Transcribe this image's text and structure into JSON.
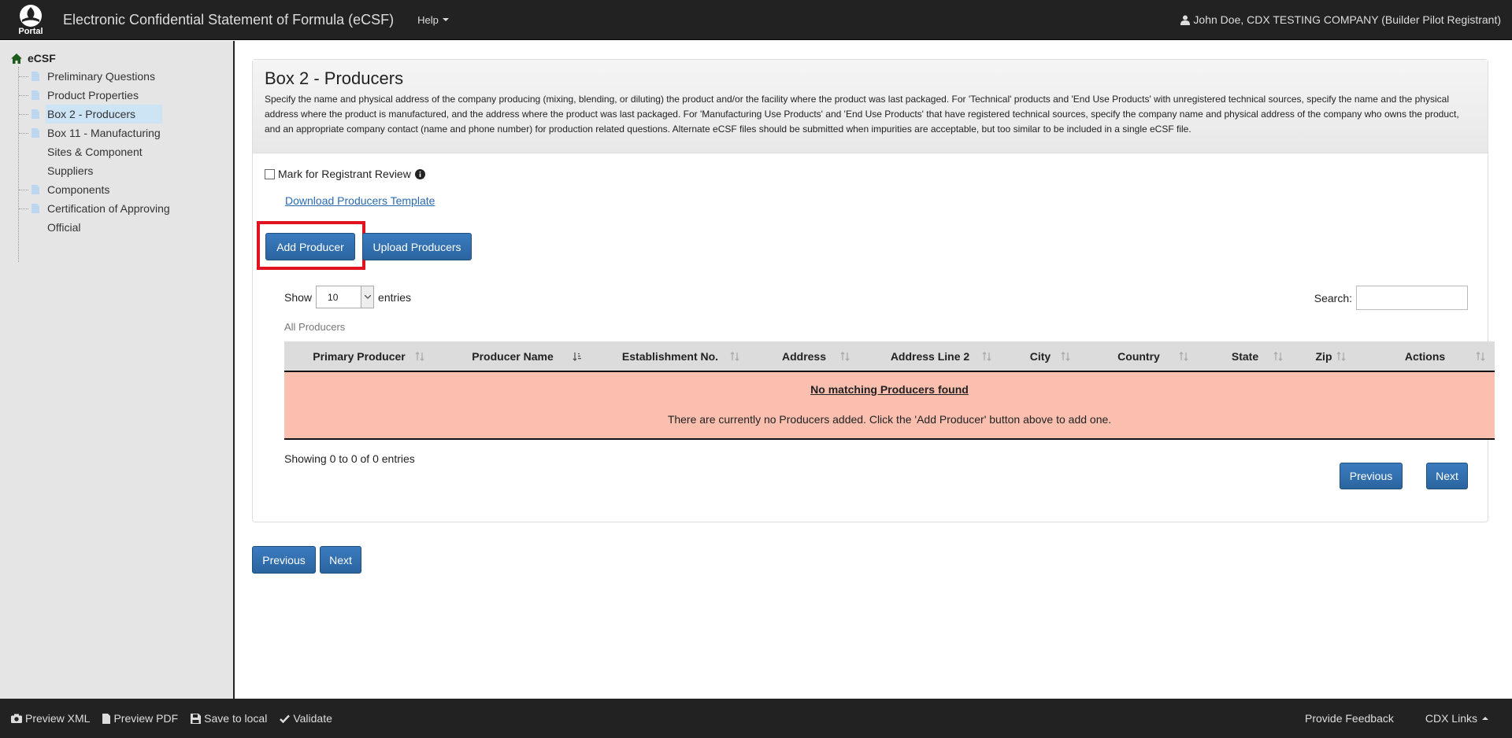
{
  "header": {
    "logo_text": "Portal",
    "app_title": "Electronic Confidential Statement of Formula (eCSF)",
    "help_label": "Help",
    "user_label": "John Doe, CDX TESTING COMPANY (Builder Pilot Registrant)"
  },
  "sidebar": {
    "root": "eCSF",
    "items": [
      {
        "label": "Preliminary Questions"
      },
      {
        "label": "Product Properties"
      },
      {
        "label": "Box 2 - Producers",
        "active": true
      },
      {
        "label": "Box 11 - Manufacturing Sites & Component Suppliers"
      },
      {
        "label": "Components"
      },
      {
        "label": "Certification of Approving Official"
      }
    ]
  },
  "main": {
    "title": "Box 2 - Producers",
    "description": "Specify the name and physical address of the company producing (mixing, blending, or diluting) the product and/or the facility where the product was last packaged. For 'Technical' products and 'End Use Products' with unregistered technical sources, specify the name and the physical address where the product is manufactured, and the address where the product was last packaged. For 'Manufacturing Use Products' and 'End Use Products' that have registered technical sources, specify the company name and physical address of the company who owns the product, and an appropriate company contact (name and phone number) for production related questions. Alternate eCSF files should be submitted when impurities are acceptable, but too similar to be included in a single eCSF file.",
    "review_label": "Mark for Registrant Review",
    "download_link": "Download Producers Template",
    "add_button": "Add Producer",
    "upload_button": "Upload Producers",
    "show_label": "Show",
    "entries_value": "10",
    "entries_label": "entries",
    "search_label": "Search:",
    "table_caption": "All Producers",
    "columns": [
      "Primary Producer",
      "Producer Name",
      "Establishment No.",
      "Address",
      "Address Line 2",
      "City",
      "Country",
      "State",
      "Zip",
      "Actions"
    ],
    "empty_title": "No matching Producers found",
    "empty_message": "There are currently no Producers added. Click the 'Add Producer' button above to add one.",
    "info_text": "Showing 0 to 0 of 0 entries",
    "prev_label": "Previous",
    "next_label": "Next"
  },
  "footer": {
    "preview_xml": "Preview XML",
    "preview_pdf": "Preview PDF",
    "save_local": "Save to local",
    "validate": "Validate",
    "feedback": "Provide Feedback",
    "cdx_links": "CDX Links"
  },
  "colors": {
    "navbar": "#222222",
    "primary_button": "#2e6da4",
    "empty_row": "#fbbfb0",
    "highlight": "#e0131e"
  }
}
